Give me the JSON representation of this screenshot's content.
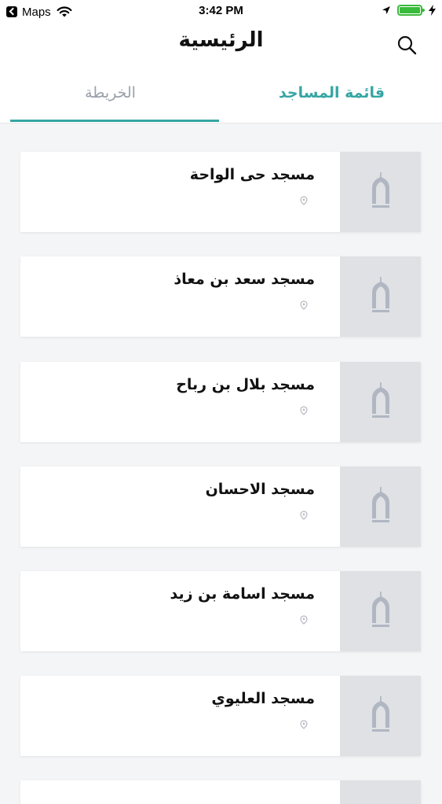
{
  "status_bar": {
    "back_app": "Maps",
    "time": "3:42 PM"
  },
  "header": {
    "title": "الرئيسية"
  },
  "tabs": {
    "list": "قائمة المساجد",
    "map": "الخريطة"
  },
  "mosques": [
    {
      "name": "مسجد حى الواحة"
    },
    {
      "name": "مسجد سعد بن معاذ"
    },
    {
      "name": "مسجد بلال بن رباح"
    },
    {
      "name": "مسجد الاحسان"
    },
    {
      "name": "مسجد اسامة بن زيد"
    },
    {
      "name": "مسجد العليوي"
    }
  ],
  "colors": {
    "accent": "#36a6a3",
    "background": "#f4f5f7",
    "thumb_placeholder": "#dfe1e4",
    "battery": "#3aba3a"
  },
  "icons": {
    "search": "search-icon",
    "pin": "location-pin-icon",
    "thumb": "mosque-placeholder-icon"
  }
}
